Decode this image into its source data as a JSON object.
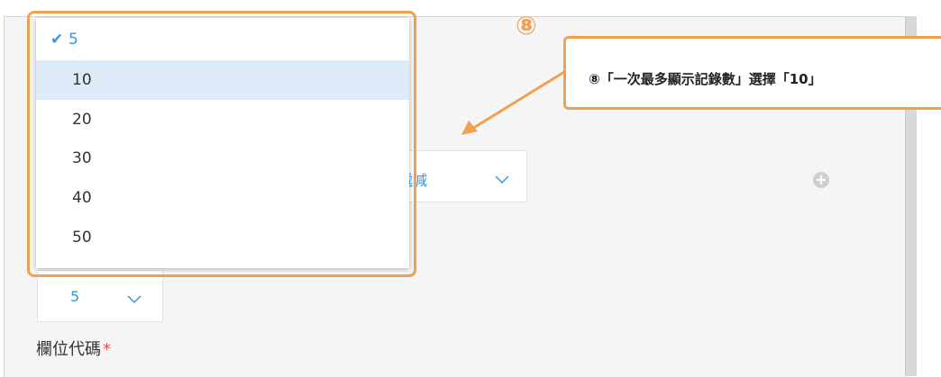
{
  "form": {
    "sort_value": "遞減",
    "records_value": "5",
    "field_code_label": "欄位代碼",
    "required_mark": "*",
    "add_button": "+"
  },
  "dropdown": {
    "options": [
      {
        "label": "5",
        "selected": true
      },
      {
        "label": "10",
        "hovered": true
      },
      {
        "label": "20"
      },
      {
        "label": "30"
      },
      {
        "label": "40"
      },
      {
        "label": "50"
      }
    ],
    "check_mark": "✔"
  },
  "annotation": {
    "step_number": "⑧",
    "callout_text": "⑧「一次最多顯示記錄數」選擇「10」",
    "accent_color": "#f0a050"
  }
}
